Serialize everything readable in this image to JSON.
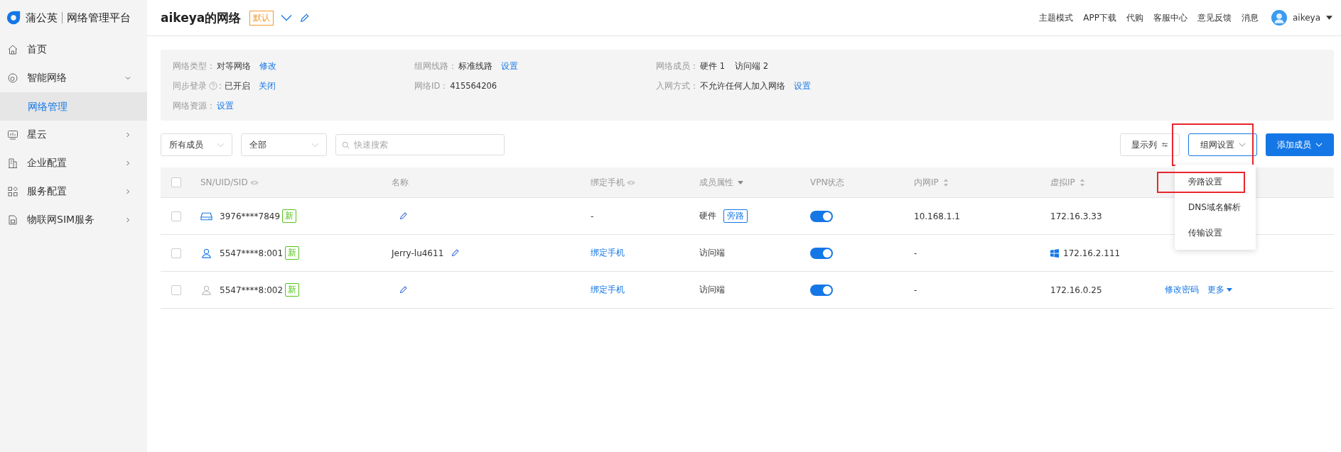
{
  "brand": {
    "name": "蒲公英",
    "subtitle": "网络管理平台"
  },
  "sidebar": {
    "items": [
      {
        "label": "首页",
        "selected": false
      },
      {
        "label": "智能网络",
        "expanded": true,
        "selected": false,
        "children": [
          {
            "label": "网络管理",
            "selected": true
          }
        ]
      },
      {
        "label": "星云",
        "expanded": false,
        "selected": false
      },
      {
        "label": "企业配置",
        "expanded": false,
        "selected": false
      },
      {
        "label": "服务配置",
        "expanded": false,
        "selected": false
      },
      {
        "label": "物联网SIM服务",
        "expanded": false,
        "selected": false
      }
    ]
  },
  "header": {
    "title": "aikeya的网络",
    "badge": "默认",
    "links": [
      "主题模式",
      "APP下载",
      "代购",
      "客服中心",
      "意见反馈",
      "消息"
    ],
    "user": "aikeya"
  },
  "info": [
    {
      "label": "网络类型：",
      "value": "对等网络",
      "link": "修改"
    },
    {
      "label": "组网线路：",
      "value": "标准线路",
      "link": "设置"
    },
    {
      "label": "网络成员：",
      "value": "硬件 1",
      "value2": "访问端 2"
    },
    {
      "label": "同步登录",
      "suffix": ":",
      "value": "已开启",
      "link": "关闭"
    },
    {
      "label": "网络ID：",
      "value": "415564206"
    },
    {
      "label": "入网方式：",
      "value": "不允许任何人加入网络",
      "link": "设置"
    },
    {
      "label": "网络资源：",
      "link": "设置"
    }
  ],
  "toolbar": {
    "filters": [
      "所有成员",
      "全部"
    ],
    "search": {
      "placeholder": "快速搜索"
    },
    "columns_button": "显示列",
    "network_settings": "组网设置",
    "add_member": "添加成员"
  },
  "menu": {
    "items": [
      {
        "label": "旁路设置",
        "highlighted": true
      },
      {
        "label": "DNS域名解析",
        "highlighted": false
      },
      {
        "label": "传输设置",
        "highlighted": false
      }
    ]
  },
  "table": {
    "all_checked": false,
    "columns": [
      "SN/UID/SID",
      "名称",
      "绑定手机",
      "成员属性",
      "VPN状态",
      "内网IP",
      "虚拟IP"
    ],
    "rows": [
      {
        "checked": false,
        "kind": "hardware",
        "online": true,
        "id": "3976****7849",
        "tag": "新",
        "name": "",
        "phone": {
          "kind": "plain",
          "text": "-"
        },
        "attr": "硬件",
        "attr_tag": "旁路",
        "vpn": true,
        "lan_ip": "10.168.1.1",
        "vip": "172.16.3.33",
        "actions": []
      },
      {
        "checked": false,
        "kind": "user",
        "online": true,
        "id": "5547****8:001",
        "tag": "新",
        "name": "Jerry-lu4611",
        "phone": {
          "kind": "link",
          "text": "绑定手机"
        },
        "attr": "访问端",
        "vpn": true,
        "lan_ip": "-",
        "windows": true,
        "vip": "172.16.2.111",
        "actions": []
      },
      {
        "checked": false,
        "kind": "user",
        "online": false,
        "id": "5547****8:002",
        "tag": "新",
        "name": "",
        "phone": {
          "kind": "link",
          "text": "绑定手机"
        },
        "attr": "访问端",
        "vpn": true,
        "lan_ip": "-",
        "vip": "172.16.0.25",
        "actions": [
          "修改密码",
          "更多"
        ]
      }
    ]
  }
}
